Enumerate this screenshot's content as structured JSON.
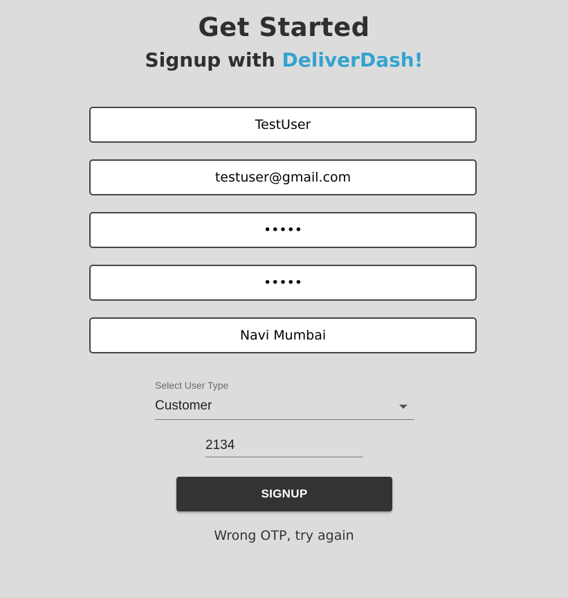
{
  "header": {
    "title": "Get Started",
    "subtitle_prefix": "Signup with ",
    "brand": "DeliverDash!"
  },
  "form": {
    "username": {
      "value": "TestUser"
    },
    "email": {
      "value": "testuser@gmail.com"
    },
    "password": {
      "value": "•••••"
    },
    "confirm_password": {
      "value": "•••••"
    },
    "city": {
      "value": "Navi Mumbai"
    },
    "user_type": {
      "label": "Select User Type",
      "selected": "Customer"
    },
    "otp": {
      "value": "2134"
    },
    "submit_label": "SIGNUP",
    "error_message": "Wrong OTP, try again"
  },
  "colors": {
    "background": "#dcdcdc",
    "brand": "#34a3cf",
    "button": "#333333"
  }
}
